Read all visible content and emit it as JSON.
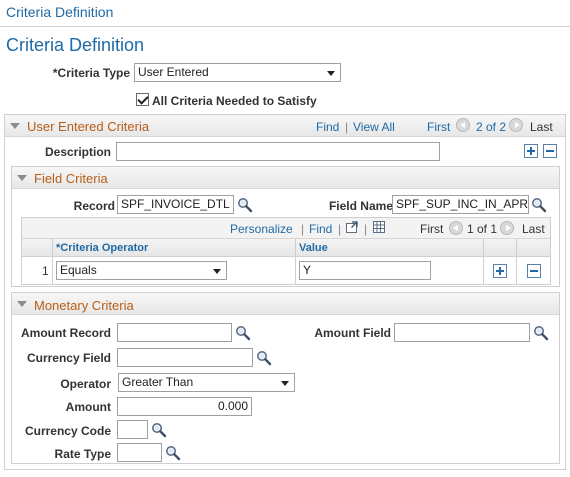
{
  "breadcrumb": "Criteria Definition",
  "page_title": "Criteria Definition",
  "criteria_type": {
    "label": "*Criteria Type",
    "value": "User Entered"
  },
  "all_criteria": {
    "label": "All Criteria Needed to Satisfy",
    "checked": true
  },
  "user_entered": {
    "title": "User Entered Criteria",
    "find": "Find",
    "separator": "|",
    "view_all": "View All",
    "first": "First",
    "range": "2 of 2",
    "last": "Last",
    "description_label": "Description",
    "description_value": ""
  },
  "field_criteria": {
    "title": "Field Criteria",
    "record_label": "Record",
    "record_value": "SPF_INVOICE_DTL",
    "field_name_label": "Field Name",
    "field_name_value": "SPF_SUP_INC_IN_APR",
    "grid": {
      "personalize": "Personalize",
      "find": "Find",
      "separator": "|",
      "first": "First",
      "range": "1 of 1",
      "last": "Last",
      "columns": [
        "*Criteria Operator",
        "Value"
      ],
      "rows": [
        {
          "num": "1",
          "operator": "Equals",
          "value": "Y"
        }
      ]
    }
  },
  "monetary": {
    "title": "Monetary Criteria",
    "amount_record_label": "Amount Record",
    "amount_record_value": "",
    "amount_field_label": "Amount Field",
    "amount_field_value": "",
    "currency_field_label": "Currency Field",
    "currency_field_value": "",
    "operator_label": "Operator",
    "operator_value": "Greater Than",
    "amount_label": "Amount",
    "amount_value": "0.000",
    "currency_code_label": "Currency Code",
    "currency_code_value": "",
    "rate_type_label": "Rate Type",
    "rate_type_value": ""
  },
  "colors": {
    "link": "#1f6aa5",
    "section_title": "#b85e18",
    "panel_border": "#cfcfcf"
  },
  "icons": [
    "lookup-icon",
    "checkbox-checked-icon",
    "collapse-arrow-icon",
    "previous-icon",
    "next-icon",
    "add-row-icon",
    "delete-row-icon",
    "view-all-icon",
    "download-icon"
  ]
}
